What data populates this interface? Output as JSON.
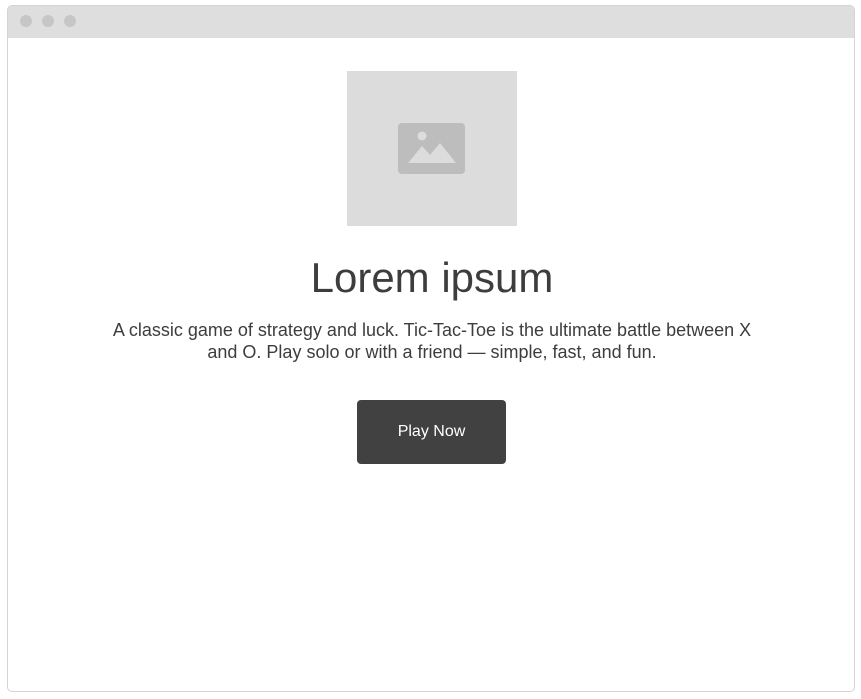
{
  "window": {
    "controls": [
      "close",
      "minimize",
      "maximize"
    ]
  },
  "hero": {
    "image_icon": "image-placeholder-icon",
    "title": "Lorem ipsum",
    "description": "A classic game of strategy and luck. Tic-Tac-Toe is the ultimate battle between X and O. Play solo or with a friend — simple, fast, and fun.",
    "cta_label": "Play Now"
  },
  "colors": {
    "titlebar": "#dedede",
    "window_dot": "#c6c6c6",
    "placeholder_bg": "#dcdcdc",
    "placeholder_icon": "#bdbdbd",
    "text": "#3d3d3d",
    "button_bg": "#414141",
    "button_text": "#ffffff"
  }
}
